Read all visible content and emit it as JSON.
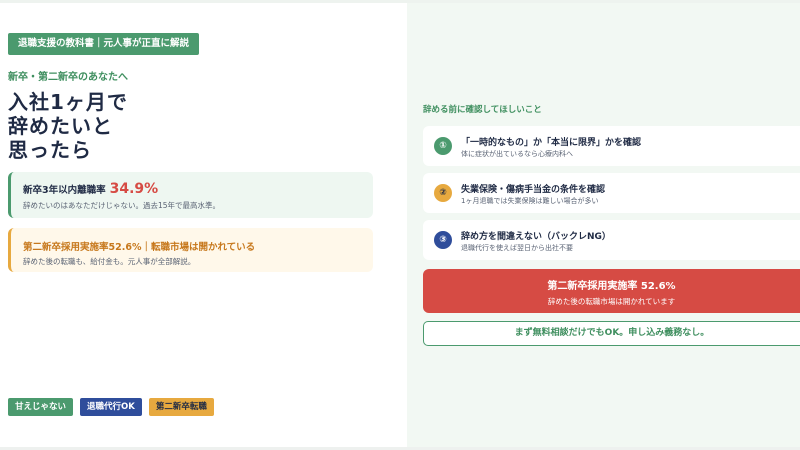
{
  "header_badge": "退職支援の教科書｜元人事が正直に解説",
  "kicker": "新卒・第二新卒のあなたへ",
  "headline": [
    "入社1ヶ月で",
    "辞めたいと",
    "思ったら"
  ],
  "stat_card": {
    "label": "新卒3年以内離職率",
    "value": "34.9%",
    "sub": "辞めたいのはあなただけじゃない。過去15年で最高水準。"
  },
  "info_card": {
    "title": "第二新卒採用実施率52.6%｜転職市場は開かれている",
    "sub": "辞めた後の転職も、給付金も。元人事が全部解説。"
  },
  "tags": [
    "甘えじゃない",
    "退職代行OK",
    "第二新卒転職"
  ],
  "checklist": {
    "heading": "辞める前に確認してほしいこと",
    "items": [
      {
        "num": "①",
        "title": "「一時的なもの」か「本当に限界」かを確認",
        "sub": "体に症状が出ているなら心療内科へ"
      },
      {
        "num": "②",
        "title": "失業保険・傷病手当金の条件を確認",
        "sub": "1ヶ月退職では失業保険は難しい場合が多い"
      },
      {
        "num": "③",
        "title": "辞め方を間違えない（バックレNG）",
        "sub": "退職代行を使えば翌日から出社不要"
      }
    ]
  },
  "highlight": {
    "title": "第二新卒採用実施率 52.6%",
    "sub": "辞めた後の転職市場は開かれています"
  },
  "cta": "まず無料相談だけでもOK。申し込み義務なし。",
  "colors": {
    "brand_green": "#4b9a6e",
    "navy": "#1f2a44",
    "red": "#d64b44",
    "orange": "#e7a93f",
    "blue": "#2f4d9b"
  }
}
